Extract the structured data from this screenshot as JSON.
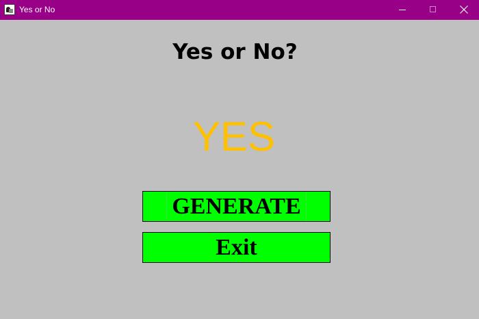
{
  "window": {
    "title": "Yes or No",
    "titlebar_color": "#990088",
    "icon": "java-cup-icon",
    "controls": {
      "minimize_icon": "minimize-icon",
      "maximize_icon": "maximize-icon",
      "close_icon": "close-icon"
    }
  },
  "main": {
    "heading": "Yes or No?",
    "answer": "YES",
    "answer_color": "#ffc000",
    "background_color": "#c0c0c0"
  },
  "buttons": {
    "generate_label": "GENERATE",
    "exit_label": "Exit",
    "button_color": "#00ff00"
  }
}
